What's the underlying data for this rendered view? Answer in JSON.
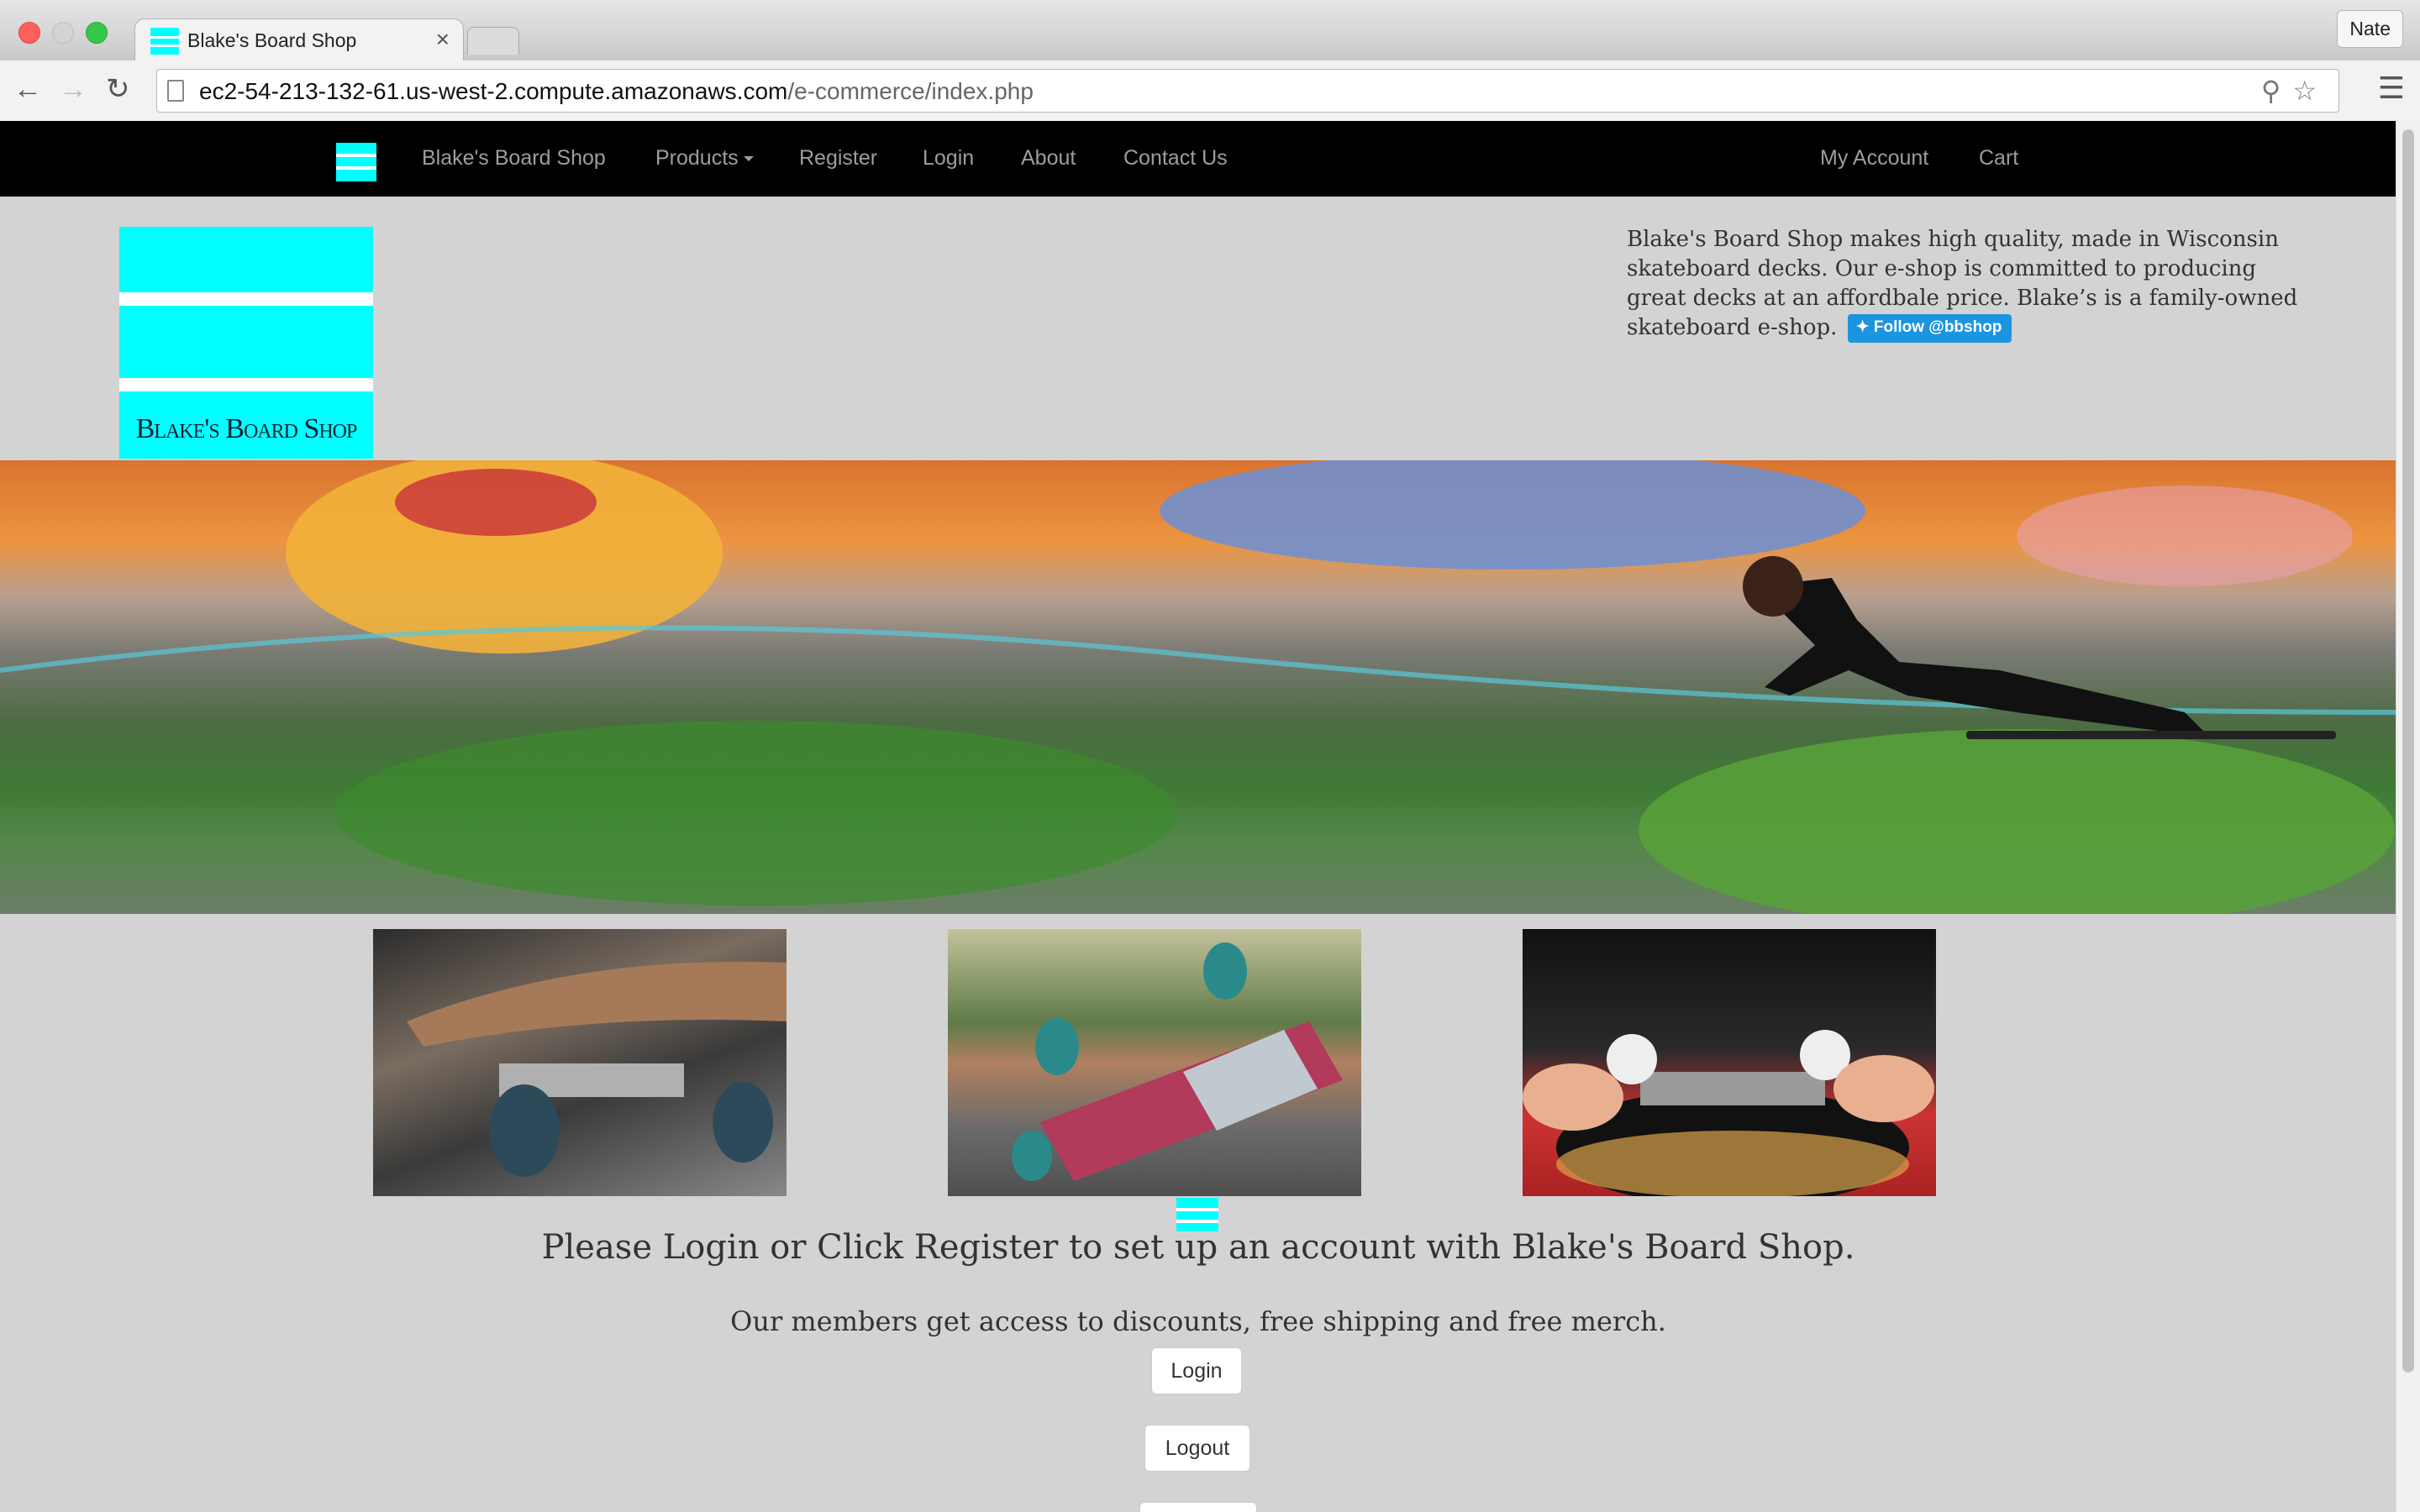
{
  "browser": {
    "tab_title": "Blake's Board Shop",
    "tab_close": "×",
    "profile_name": "Nate",
    "url_host": "ec2-54-213-132-61.us-west-2.compute.amazonaws.com",
    "url_path": "/e-commerce/index.php",
    "icons": [
      "back-icon",
      "forward-icon",
      "reload-icon",
      "page-icon",
      "zoom-icon",
      "star-icon",
      "menu-icon"
    ]
  },
  "site_nav": {
    "brand": "Blake's Board Shop",
    "products": "Products",
    "register": "Register",
    "login": "Login",
    "about": "About",
    "contact": "Contact Us",
    "my_account": "My Account",
    "cart": "Cart"
  },
  "logo": {
    "text": "Blake's Board Shop",
    "color": "#00ffff"
  },
  "blurb": {
    "text": "Blake's Board Shop makes high quality, made in Wisconsin skateboard decks. Our e-shop is committed to producing great decks at an affordbale price. Blake’s is a family-owned skateboard e-shop.",
    "twitter_button": "Follow @bbshop"
  },
  "main": {
    "headline": "Please Login or Click Register to set up an account with Blake's Board Shop.",
    "subline": "Our members get access to discounts, free shipping and free merch.",
    "login_button": "Login",
    "logout_button": "Logout"
  }
}
